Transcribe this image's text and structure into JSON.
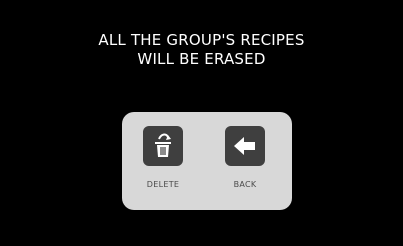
{
  "dialog": {
    "message_line1": "ALL THE GROUP'S RECIPES",
    "message_line2": "WILL BE ERASED"
  },
  "actions": {
    "delete_label": "DELETE",
    "back_label": "BACK"
  },
  "icons": {
    "delete": "trash-icon",
    "back": "arrow-left-icon"
  },
  "colors": {
    "background": "#000000",
    "panel": "#d8d8d8",
    "tile": "#3f3f3f",
    "text": "#ffffff",
    "label": "#4a4a4a"
  }
}
